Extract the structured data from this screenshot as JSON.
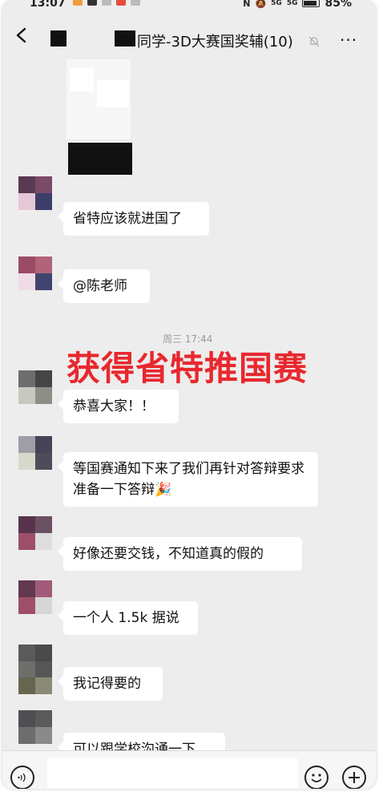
{
  "status_bar": {
    "time": "13:07",
    "signal_labels": [
      "5G",
      "5G"
    ],
    "battery_percent": "85%"
  },
  "navbar": {
    "title": "同学-3D大赛国奖辅(10)",
    "more_label": "···"
  },
  "messages": [
    {
      "text": "省特应该就进国了"
    },
    {
      "text": "@陈老师"
    },
    {
      "text": "恭喜大家！！"
    },
    {
      "text": "等国赛通知下来了我们再针对答辩要求准备一下答辩🎉"
    },
    {
      "text": "好像还要交钱，不知道真的假的"
    },
    {
      "text": "一个人 1.5k 据说"
    },
    {
      "text": "我记得要的"
    },
    {
      "text": "可以跟学校沟通一下"
    }
  ],
  "timestamp": "周三 17:44",
  "overlay_caption": "获得省特推国赛",
  "input_bar": {
    "message_value": ""
  },
  "colors": {
    "caption_red": "#e8282e",
    "chat_background": "#ededed"
  }
}
